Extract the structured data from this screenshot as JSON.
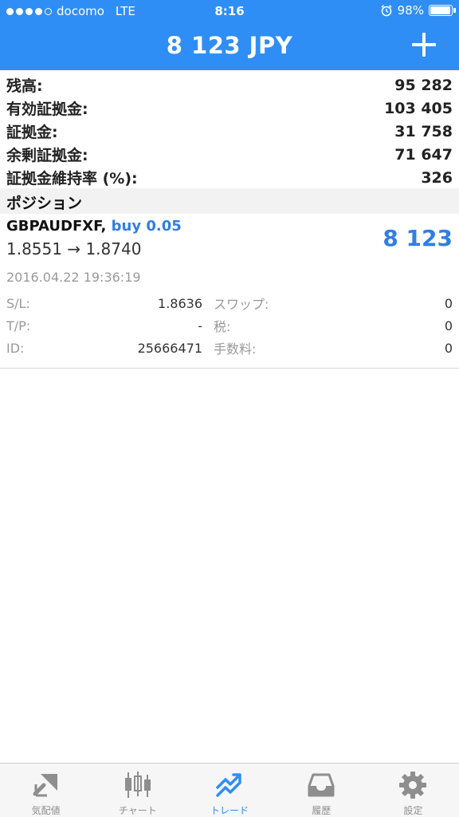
{
  "status_bar": {
    "carrier": "docomo",
    "network": "LTE",
    "time": "8:16",
    "battery": "98%"
  },
  "header": {
    "title": "8 123 JPY",
    "add_icon": "plus-icon"
  },
  "summary": [
    {
      "label": "残高:",
      "value": "95 282"
    },
    {
      "label": "有効証拠金:",
      "value": "103 405"
    },
    {
      "label": "証拠金:",
      "value": "31 758"
    },
    {
      "label": "余剰証拠金:",
      "value": "71 647"
    },
    {
      "label": "証拠金維持率 (%):",
      "value": "326"
    }
  ],
  "positions": {
    "section_title": "ポジション",
    "items": [
      {
        "symbol": "GBPAUDFXF,",
        "side": "buy 0.05",
        "prices": "1.8551 → 1.8740",
        "profit": "8 123",
        "datetime": "2016.04.22 19:36:19",
        "details": [
          {
            "l1": "S/L:",
            "v1": "1.8636",
            "l2": "スワップ:",
            "v2": "0"
          },
          {
            "l1": "T/P:",
            "v1": "-",
            "l2": "税:",
            "v2": "0"
          },
          {
            "l1": "ID:",
            "v1": "25666471",
            "l2": "手数料:",
            "v2": "0"
          }
        ]
      }
    ]
  },
  "tabs": [
    {
      "label": "気配値",
      "icon": "quotes-icon"
    },
    {
      "label": "チャート",
      "icon": "candlestick-icon"
    },
    {
      "label": "トレード",
      "icon": "trade-icon",
      "active": true
    },
    {
      "label": "履歴",
      "icon": "history-tray-icon"
    },
    {
      "label": "設定",
      "icon": "gear-icon"
    }
  ],
  "colors": {
    "header": "#2f8ef5",
    "accent": "#2f7ee8",
    "tab_inactive": "#8e8e8e"
  }
}
